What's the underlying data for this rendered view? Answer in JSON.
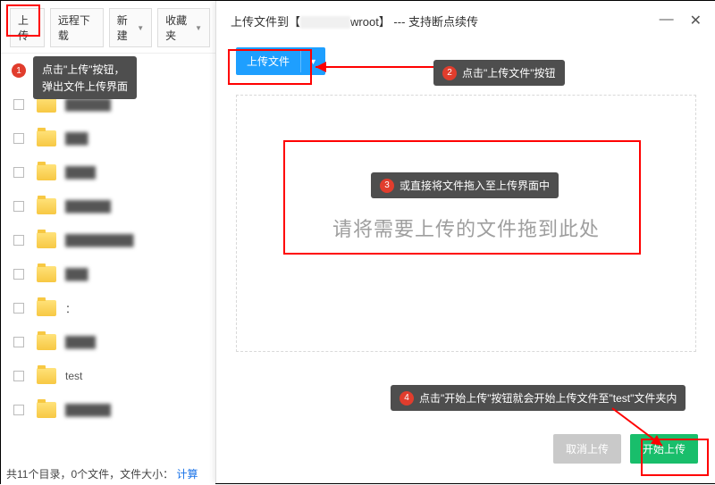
{
  "toolbar": {
    "upload": "上传",
    "remote_download": "远程下载",
    "new": "新建",
    "favorites": "收藏夹"
  },
  "files": {
    "test_label": "test"
  },
  "status": {
    "text_prefix": "共11个目录，0个文件，文件大小：",
    "calc": "计算"
  },
  "modal": {
    "title_prefix": "上传文件到【",
    "title_suffix": "wroot】 --- 支持断点续传",
    "upload_file_btn": "上传文件",
    "drag_hint": "请将需要上传的文件拖到此处",
    "cancel": "取消上传",
    "start": "开始上传"
  },
  "annotations": {
    "n1": "1",
    "tip1_line1": "点击\"上传\"按钮，",
    "tip1_line2": "弹出文件上传界面",
    "n2": "2",
    "tip2": "点击\"上传文件\"按钮",
    "n3": "3",
    "tip3": "或直接将文件拖入至上传界面中",
    "n4": "4",
    "tip4": "点击\"开始上传\"按钮就会开始上传文件至\"test\"文件夹内",
    "arrow_color": "#ff0000"
  }
}
